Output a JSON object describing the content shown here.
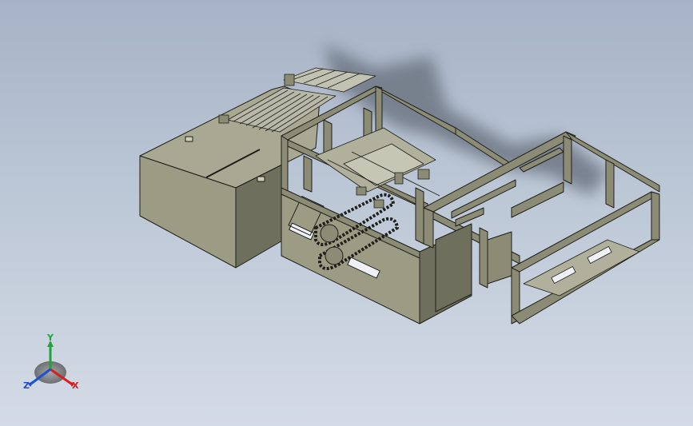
{
  "viewport": {
    "background_top": "#a6b3c6",
    "background_bottom": "#d4dbe6"
  },
  "model": {
    "body_face_light": "#9c9c84",
    "body_face_top": "#a9a993",
    "body_face_dark": "#6f6f5e",
    "frame_color": "#8c8c76",
    "edge_color": "#1e1e1a",
    "shadow_color": "#6e7784"
  },
  "triad": {
    "x_label": "X",
    "y_label": "Y",
    "z_label": "Z",
    "x_color": "#d42020",
    "y_color": "#1fa53a",
    "z_color": "#2050d0"
  }
}
